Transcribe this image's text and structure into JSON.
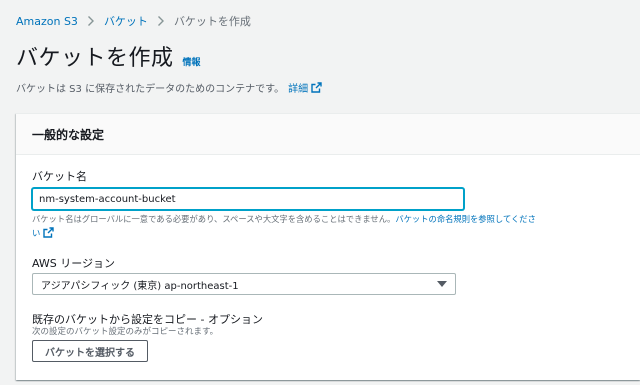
{
  "breadcrumb": {
    "items": [
      "Amazon S3",
      "バケット",
      "バケットを作成"
    ]
  },
  "page": {
    "title": "バケットを作成",
    "info_label": "情報",
    "description": "バケットは S3 に保存されたデータのためのコンテナです。",
    "details_link": "詳細"
  },
  "panel": {
    "title": "一般的な設定",
    "bucket_name": {
      "label": "バケット名",
      "value": "nm-system-account-bucket",
      "hint_text": "バケット名はグローバルに一意である必要があり、スペースや大文字を含めることはできません。",
      "hint_link": "バケットの命名規則を参照してくださ",
      "hint_link_cont": "い"
    },
    "region": {
      "label": "AWS リージョン",
      "selected": "アジアパシフィック (東京) ap-northeast-1"
    },
    "copy_settings": {
      "label": "既存のバケットから設定をコピー - オプション",
      "hint": "次の設定のバケット設定のみがコピーされます。",
      "button_label": "バケットを選択する"
    }
  },
  "colors": {
    "link": "#0073bb",
    "focus_border": "#00a1c9",
    "background": "#f2f3f3"
  },
  "icons": [
    "chevron-right-icon",
    "external-link-icon",
    "caret-down-icon"
  ]
}
